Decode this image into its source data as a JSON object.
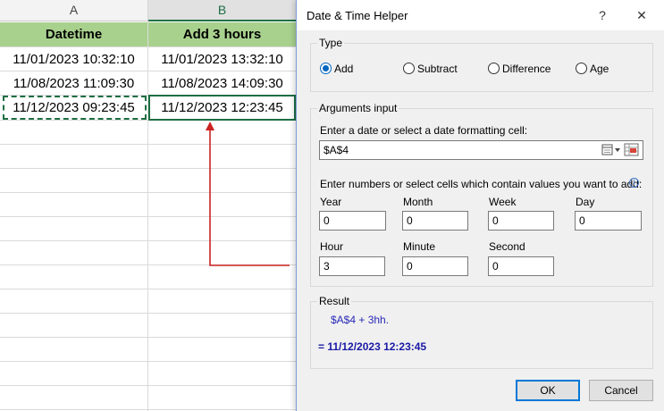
{
  "sheet": {
    "col_a": "A",
    "col_b": "B",
    "header_a": "Datetime",
    "header_b": "Add 3 hours",
    "rows": [
      {
        "a": "11/01/2023 10:32:10",
        "b": "11/01/2023 13:32:10"
      },
      {
        "a": "11/08/2023 11:09:30",
        "b": "11/08/2023 14:09:30"
      },
      {
        "a": "11/12/2023 09:23:45",
        "b": "11/12/2023 12:23:45"
      }
    ],
    "colors": {
      "header_fill": "#a9d18e",
      "selection": "#1e6e43",
      "arrow": "#cc2222"
    }
  },
  "dialog": {
    "title": "Date & Time Helper",
    "help": "?",
    "close": "✕",
    "type_legend": "Type",
    "types": [
      "Add",
      "Subtract",
      "Difference",
      "Age"
    ],
    "selected_type": "Add",
    "args_legend": "Arguments input",
    "date_prompt": "Enter a date or select a date formatting cell:",
    "date_value": "$A$4",
    "numbers_prompt": "Enter numbers or select cells which contain values you want to add:",
    "info_icon": "i",
    "fields": {
      "year": {
        "label": "Year",
        "value": "0"
      },
      "month": {
        "label": "Month",
        "value": "0"
      },
      "week": {
        "label": "Week",
        "value": "0"
      },
      "day": {
        "label": "Day",
        "value": "0"
      },
      "hour": {
        "label": "Hour",
        "value": "3"
      },
      "minute": {
        "label": "Minute",
        "value": "0"
      },
      "second": {
        "label": "Second",
        "value": "0"
      }
    },
    "result_legend": "Result",
    "result_expr": "$A$4 + 3hh.",
    "result_value": "=  11/12/2023 12:23:45",
    "ok": "OK",
    "cancel": "Cancel",
    "colors": {
      "accent": "#0078d7",
      "result_text": "#1a1aa6"
    }
  }
}
